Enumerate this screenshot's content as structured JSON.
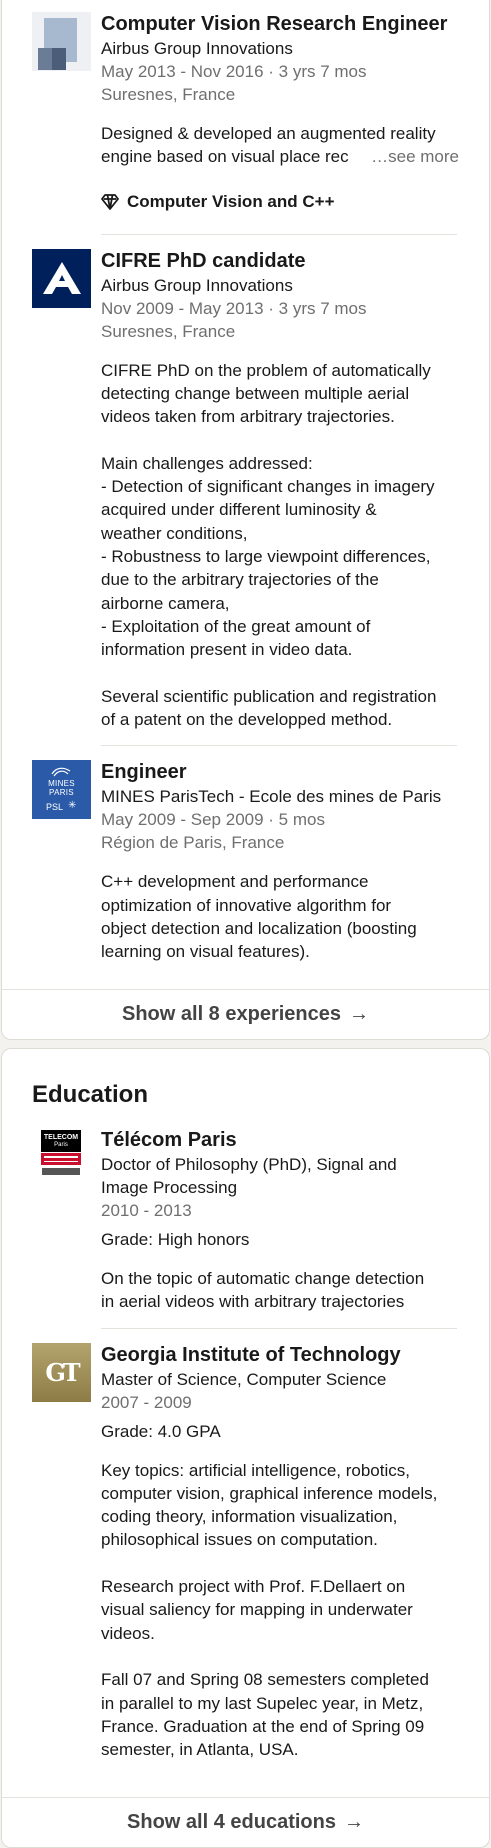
{
  "experience": {
    "items": [
      {
        "title": "Computer Vision Research Engineer",
        "company": "Airbus Group Innovations",
        "dates": "May 2013 - Nov 2016 · 3 yrs 7 mos",
        "location": "Suresnes, France",
        "description": "Designed & developed an augmented reality\nengine based on visual place rec",
        "see_more": "…see more",
        "skill": "Computer Vision and C++",
        "logo_icon": "placeholder-company-logo"
      },
      {
        "title": "CIFRE PhD candidate",
        "company": "Airbus Group Innovations",
        "dates": "Nov 2009 - May 2013 · 3 yrs 7 mos",
        "location": "Suresnes, France",
        "description": "CIFRE PhD on the problem of automatically\ndetecting change between multiple aerial\nvideos taken from arbitrary trajectories.\n\nMain challenges addressed:\n- Detection of significant changes in imagery\nacquired under different luminosity &\nweather conditions,\n- Robustness to large viewpoint differences,\ndue to the arbitrary trajectories of the\nairborne camera,\n- Exploitation of the great amount of\ninformation present in video data.\n\nSeveral scientific publication and registration\nof a patent on the developped method.",
        "logo_icon": "airbus-logo"
      },
      {
        "title": "Engineer",
        "company": "MINES ParisTech - Ecole des mines de Paris",
        "dates": "May 2009 - Sep 2009 · 5 mos",
        "location": "Région de Paris, France",
        "description": "C++ development and performance\noptimization of innovative algorithm for\nobject detection and localization (boosting\nlearning on visual features).",
        "logo_icon": "mines-paris-logo",
        "logo_text_1": "MINES",
        "logo_text_2": "PARIS",
        "logo_text_3": "PSL"
      }
    ],
    "show_all": "Show all 8 experiences",
    "arrow": "→"
  },
  "education": {
    "heading": "Education",
    "items": [
      {
        "school": "Télécom Paris",
        "degree": "Doctor of Philosophy (PhD), Signal and\nImage Processing",
        "dates": "2010 - 2013",
        "grade": "Grade: High honors",
        "description": "On the topic of automatic change detection\nin aerial videos with arbitrary trajectories",
        "logo_icon": "telecom-paris-logo",
        "logo_text_1": "TELECOM",
        "logo_text_2": "Paris"
      },
      {
        "school": "Georgia Institute of Technology",
        "degree": "Master of Science, Computer Science",
        "dates": "2007 - 2009",
        "grade": "Grade: 4.0 GPA",
        "description": "Key topics: artificial intelligence, robotics,\ncomputer vision, graphical inference models,\ncoding theory, information visualization,\nphilosophical issues on computation.\n\nResearch project with Prof. F.Dellaert on\nvisual saliency for mapping in underwater\nvideos.\n\nFall 07 and Spring 08 semesters completed\nin parallel to my last Supelec year, in Metz,\nFrance. Graduation at the end of Spring 09\nsemester, in Atlanta, USA.",
        "logo_icon": "georgia-tech-logo",
        "logo_text": "GT"
      }
    ],
    "show_all": "Show all 4 educations",
    "arrow": "→"
  },
  "colors": {
    "background": "#f4f2ee",
    "card": "#ffffff",
    "text_primary": "#191919",
    "text_secondary": "#6f6f6f",
    "airbus_blue": "#00205b",
    "mines_blue": "#2a5aa8",
    "gt_gold": "#a4925a"
  }
}
